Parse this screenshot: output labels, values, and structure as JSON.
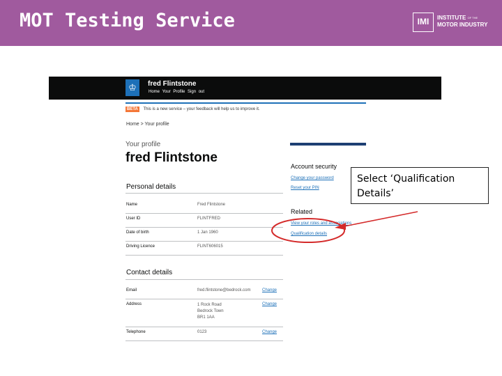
{
  "slide": {
    "title": "MOT Testing Service",
    "logo": {
      "mark": "IMI",
      "line1": "INSTITUTE",
      "of_the": "OF THE",
      "line2": "MOTOR INDUSTRY"
    }
  },
  "screenshot": {
    "header": {
      "crest_icon": "crown-icon",
      "user_name": "fred Flintstone",
      "nav": [
        "Home",
        "Your Profile",
        "Sign out"
      ]
    },
    "phase": {
      "tag": "BETA",
      "text": "This is a new service – your feedback will help us to improve it."
    },
    "breadcrumb": "Home > Your profile",
    "page": {
      "caption": "Your profile",
      "title": "fred Flintstone"
    },
    "personal_details": {
      "heading": "Personal details",
      "rows": [
        {
          "label": "Name",
          "value": "Fred Flintstone"
        },
        {
          "label": "User ID",
          "value": "FLINTFRED"
        },
        {
          "label": "Date of birth",
          "value": "1 Jan 1960"
        },
        {
          "label": "Driving Licence",
          "value": "FLINT606015"
        }
      ]
    },
    "contact_details": {
      "heading": "Contact details",
      "change_label": "Change",
      "rows": [
        {
          "label": "Email",
          "value": "fred.flintstone@bedrock.com"
        },
        {
          "label": "Address",
          "value": "1 Rock Road",
          "value2": "Bedrock Town",
          "value3": "BR1 1AA"
        },
        {
          "label": "Telephone",
          "value": "0123"
        }
      ]
    },
    "sidebar": {
      "account_security": {
        "heading": "Account security",
        "links": [
          "Change your password",
          "Reset your PIN"
        ]
      },
      "related": {
        "heading": "Related",
        "links": [
          "View your roles and associations",
          "Qualification details"
        ]
      }
    }
  },
  "callout": {
    "line1": "Select ‘Qualification",
    "line2": "Details’"
  },
  "colors": {
    "header_bg": "#a05a9e",
    "gov_black": "#0b0c0c",
    "link_blue": "#1d70b8",
    "annotation_red": "#d42a2a"
  }
}
